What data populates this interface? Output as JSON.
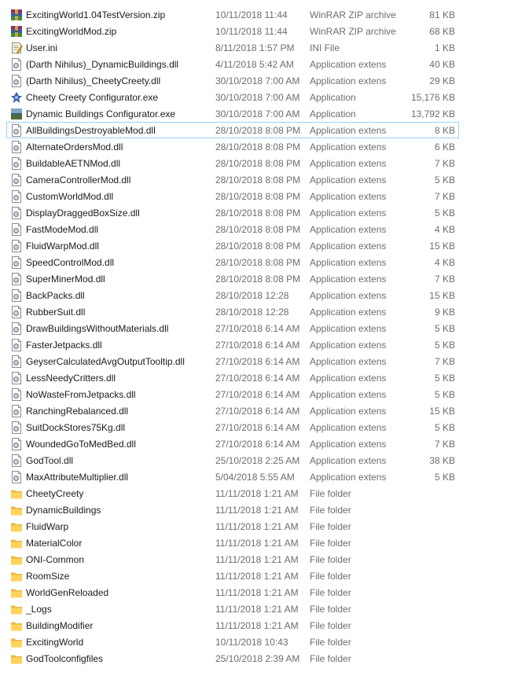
{
  "files": [
    {
      "name": "ExcitingWorld1.04TestVersion.zip",
      "date": "10/11/2018 11:44",
      "type": "WinRAR ZIP archive",
      "size": "81 KB",
      "icon": "winrar-archive-icon"
    },
    {
      "name": "ExcitingWorldMod.zip",
      "date": "10/11/2018 11:44",
      "type": "WinRAR ZIP archive",
      "size": "68 KB",
      "icon": "winrar-archive-icon"
    },
    {
      "name": "User.ini",
      "date": "8/11/2018 1:57 PM",
      "type": "INI File",
      "size": "1 KB",
      "icon": "ini-file-icon"
    },
    {
      "name": "(Darth Nihilus)_DynamicBuildings.dll",
      "date": "4/11/2018 5:42 AM",
      "type": "Application extens",
      "size": "40 KB",
      "icon": "dll-file-icon"
    },
    {
      "name": "(Darth Nihilus)_CheetyCreety.dll",
      "date": "30/10/2018 7:00 AM",
      "type": "Application extens",
      "size": "29 KB",
      "icon": "dll-file-icon"
    },
    {
      "name": "Cheety Creety Configurator.exe",
      "date": "30/10/2018 7:00 AM",
      "type": "Application",
      "size": "15,176 KB",
      "icon": "configurator-app-icon"
    },
    {
      "name": "Dynamic Buildings Configurator.exe",
      "date": "30/10/2018 7:00 AM",
      "type": "Application",
      "size": "13,792 KB",
      "icon": "landscape-app-icon"
    },
    {
      "name": "AllBuildingsDestroyableMod.dll",
      "date": "28/10/2018 8:08 PM",
      "type": "Application extens",
      "size": "8 KB",
      "icon": "dll-file-icon",
      "selected": true
    },
    {
      "name": "AlternateOrdersMod.dll",
      "date": "28/10/2018 8:08 PM",
      "type": "Application extens",
      "size": "6 KB",
      "icon": "dll-file-icon"
    },
    {
      "name": "BuildableAETNMod.dll",
      "date": "28/10/2018 8:08 PM",
      "type": "Application extens",
      "size": "7 KB",
      "icon": "dll-file-icon"
    },
    {
      "name": "CameraControllerMod.dll",
      "date": "28/10/2018 8:08 PM",
      "type": "Application extens",
      "size": "5 KB",
      "icon": "dll-file-icon"
    },
    {
      "name": "CustomWorldMod.dll",
      "date": "28/10/2018 8:08 PM",
      "type": "Application extens",
      "size": "7 KB",
      "icon": "dll-file-icon"
    },
    {
      "name": "DisplayDraggedBoxSize.dll",
      "date": "28/10/2018 8:08 PM",
      "type": "Application extens",
      "size": "5 KB",
      "icon": "dll-file-icon"
    },
    {
      "name": "FastModeMod.dll",
      "date": "28/10/2018 8:08 PM",
      "type": "Application extens",
      "size": "4 KB",
      "icon": "dll-file-icon"
    },
    {
      "name": "FluidWarpMod.dll",
      "date": "28/10/2018 8:08 PM",
      "type": "Application extens",
      "size": "15 KB",
      "icon": "dll-file-icon"
    },
    {
      "name": "SpeedControlMod.dll",
      "date": "28/10/2018 8:08 PM",
      "type": "Application extens",
      "size": "4 KB",
      "icon": "dll-file-icon"
    },
    {
      "name": "SuperMinerMod.dll",
      "date": "28/10/2018 8:08 PM",
      "type": "Application extens",
      "size": "7 KB",
      "icon": "dll-file-icon"
    },
    {
      "name": "BackPacks.dll",
      "date": "28/10/2018 12:28",
      "type": "Application extens",
      "size": "15 KB",
      "icon": "dll-file-icon"
    },
    {
      "name": "RubberSuit.dll",
      "date": "28/10/2018 12:28",
      "type": "Application extens",
      "size": "9 KB",
      "icon": "dll-file-icon"
    },
    {
      "name": "DrawBuildingsWithoutMaterials.dll",
      "date": "27/10/2018 6:14 AM",
      "type": "Application extens",
      "size": "5 KB",
      "icon": "dll-file-icon"
    },
    {
      "name": "FasterJetpacks.dll",
      "date": "27/10/2018 6:14 AM",
      "type": "Application extens",
      "size": "5 KB",
      "icon": "dll-file-icon"
    },
    {
      "name": "GeyserCalculatedAvgOutputTooltip.dll",
      "date": "27/10/2018 6:14 AM",
      "type": "Application extens",
      "size": "7 KB",
      "icon": "dll-file-icon"
    },
    {
      "name": "LessNeedyCritters.dll",
      "date": "27/10/2018 6:14 AM",
      "type": "Application extens",
      "size": "5 KB",
      "icon": "dll-file-icon"
    },
    {
      "name": "NoWasteFromJetpacks.dll",
      "date": "27/10/2018 6:14 AM",
      "type": "Application extens",
      "size": "5 KB",
      "icon": "dll-file-icon"
    },
    {
      "name": "RanchingRebalanced.dll",
      "date": "27/10/2018 6:14 AM",
      "type": "Application extens",
      "size": "15 KB",
      "icon": "dll-file-icon"
    },
    {
      "name": "SuitDockStores75Kg.dll",
      "date": "27/10/2018 6:14 AM",
      "type": "Application extens",
      "size": "5 KB",
      "icon": "dll-file-icon"
    },
    {
      "name": "WoundedGoToMedBed.dll",
      "date": "27/10/2018 6:14 AM",
      "type": "Application extens",
      "size": "7 KB",
      "icon": "dll-file-icon"
    },
    {
      "name": "GodTool.dll",
      "date": "25/10/2018 2:25 AM",
      "type": "Application extens",
      "size": "38 KB",
      "icon": "dll-file-icon"
    },
    {
      "name": "MaxAttributeMultiplier.dll",
      "date": "5/04/2018 5:55 AM",
      "type": "Application extens",
      "size": "5 KB",
      "icon": "dll-file-icon"
    },
    {
      "name": "CheetyCreety",
      "date": "11/11/2018 1:21 AM",
      "type": "File folder",
      "size": "",
      "icon": "folder-icon"
    },
    {
      "name": "DynamicBuildings",
      "date": "11/11/2018 1:21 AM",
      "type": "File folder",
      "size": "",
      "icon": "folder-icon"
    },
    {
      "name": "FluidWarp",
      "date": "11/11/2018 1:21 AM",
      "type": "File folder",
      "size": "",
      "icon": "folder-icon"
    },
    {
      "name": "MaterialColor",
      "date": "11/11/2018 1:21 AM",
      "type": "File folder",
      "size": "",
      "icon": "folder-icon"
    },
    {
      "name": "ONI-Common",
      "date": "11/11/2018 1:21 AM",
      "type": "File folder",
      "size": "",
      "icon": "folder-icon"
    },
    {
      "name": "RoomSize",
      "date": "11/11/2018 1:21 AM",
      "type": "File folder",
      "size": "",
      "icon": "folder-icon"
    },
    {
      "name": "WorldGenReloaded",
      "date": "11/11/2018 1:21 AM",
      "type": "File folder",
      "size": "",
      "icon": "folder-icon"
    },
    {
      "name": "_Logs",
      "date": "11/11/2018 1:21 AM",
      "type": "File folder",
      "size": "",
      "icon": "folder-icon"
    },
    {
      "name": "BuildingModifier",
      "date": "11/11/2018 1:21 AM",
      "type": "File folder",
      "size": "",
      "icon": "folder-icon"
    },
    {
      "name": "ExcitingWorld",
      "date": "10/11/2018 10:43",
      "type": "File folder",
      "size": "",
      "icon": "folder-icon"
    },
    {
      "name": "GodToolconfigfiles",
      "date": "25/10/2018 2:39 AM",
      "type": "File folder",
      "size": "",
      "icon": "folder-icon"
    }
  ],
  "colors": {
    "selection_border": "#99d1ff",
    "secondary_text": "#6d6d6d",
    "folder": "#ffd35c"
  }
}
